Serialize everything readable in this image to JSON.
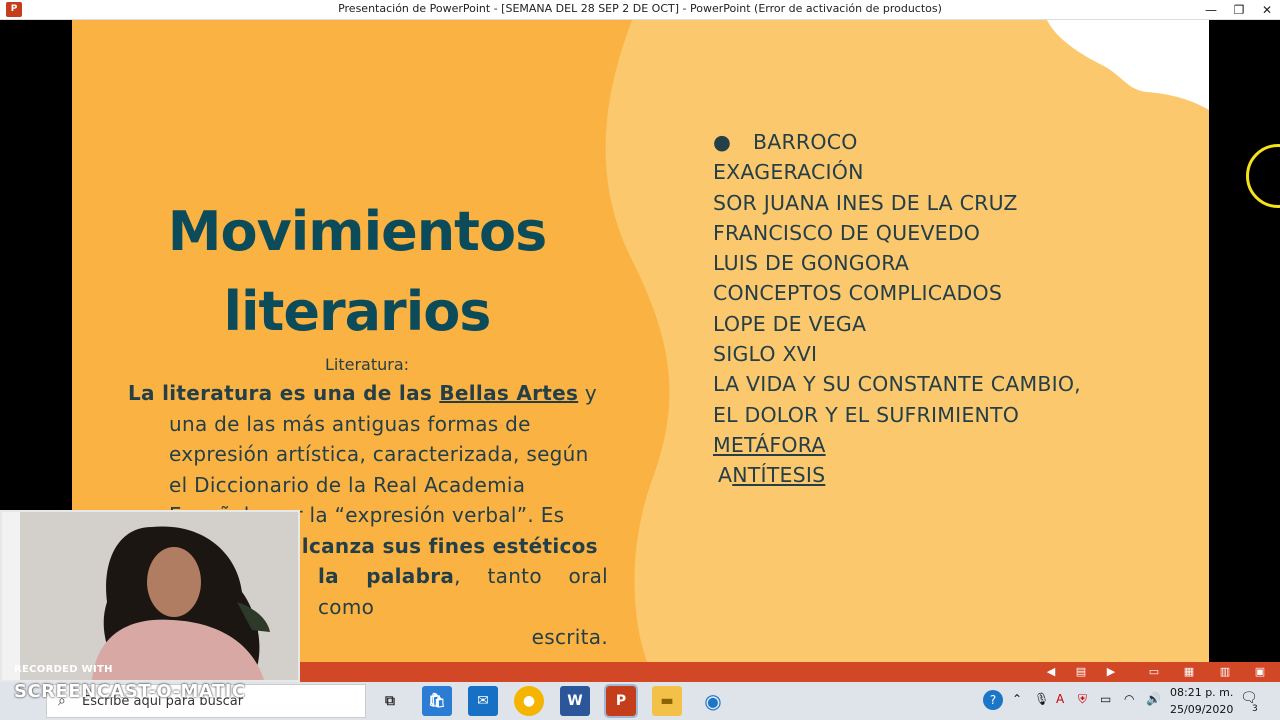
{
  "window": {
    "app_icon": "P",
    "title": "Presentación de PowerPoint - [SEMANA DEL 28 SEP 2 DE OCT] - PowerPoint (Error de activación de productos)",
    "minimize": "—",
    "restore": "❐",
    "close": "✕"
  },
  "slide": {
    "title_line1": "Movimientos",
    "title_line2": "literarios",
    "heading": "Literatura:",
    "body": {
      "p1_bold_start": "La literatura es una de las ",
      "p1_link": "Bellas Artes",
      "p1_after": " y",
      "line2": "una de las más antiguas formas de",
      "line3": "expresión artística, caracterizada, según",
      "line4": "el Diccionario de la Real Academia",
      "line5": "Española por la “expresión verbal”. Es",
      "line6_bold": "alcanza sus fines estéticos",
      "line7_bold": "la palabra",
      "line7_after": ", tanto oral como",
      "line8": "escrita."
    },
    "list": {
      "bullet": "●",
      "items": [
        "BARROCO",
        "EXAGERACIÓN",
        "SOR JUANA INES DE LA CRUZ",
        "FRANCISCO DE QUEVEDO",
        "LUIS DE GONGORA",
        "CONCEPTOS COMPLICADOS",
        "LOPE DE VEGA",
        "SIGLO XVI",
        "LA VIDA Y SU CONSTANTE CAMBIO,",
        "EL DOLOR Y EL SUFRIMIENTO",
        "METÁFORA"
      ],
      "last_prefix": "A",
      "last_underlined": "NTÍTESIS"
    },
    "colors": {
      "background": "#fab342",
      "blob": "#fcc86d",
      "text": "#243f48",
      "title": "#0c4b5a"
    }
  },
  "statusbar": {
    "color": "#d24726"
  },
  "taskbar": {
    "search_placeholder": "Escribe aquí para buscar",
    "apps": [
      "task-view",
      "store",
      "mail",
      "chrome",
      "word",
      "powerpoint",
      "explorer",
      "cortana"
    ],
    "time": "08:21 p. m.",
    "date": "25/09/2020",
    "notifications": "3"
  },
  "overlay": {
    "recorded_with": "RECORDED WITH",
    "brand": "SCREENCAST-O-MATIC"
  }
}
